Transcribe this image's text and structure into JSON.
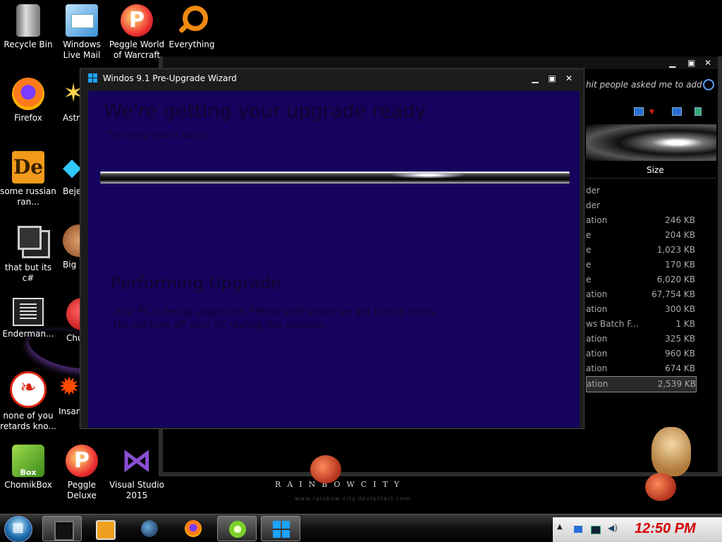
{
  "desktop_icons": [
    {
      "label": "Recycle Bin",
      "icon": "recycle-bin-icon"
    },
    {
      "label": "Windows Live Mail",
      "icon": "mail-icon"
    },
    {
      "label": "Peggle World of Warcraft",
      "icon": "peggle-icon"
    },
    {
      "label": "Everything",
      "icon": "magnifier-icon"
    },
    {
      "label": "Firefox",
      "icon": "firefox-icon"
    },
    {
      "label": "Astr De",
      "icon": "star-icon"
    },
    {
      "label": "some russian ran...",
      "icon": "de-icon"
    },
    {
      "label": "Beje De",
      "icon": "gem-icon"
    },
    {
      "label": "that but its c#",
      "icon": "windows-stack-icon"
    },
    {
      "label": "Big I De",
      "icon": "pig-icon"
    },
    {
      "label": "Enderman...",
      "icon": "list-window-icon"
    },
    {
      "label": "Chu De",
      "icon": "red-ball-icon"
    },
    {
      "label": "none of you retards kno...",
      "icon": "red-dragon-icon"
    },
    {
      "label": "Insan De",
      "icon": "burst-icon"
    },
    {
      "label": "ChomikBox",
      "icon": "chomikbox-icon"
    },
    {
      "label": "Peggle Deluxe",
      "icon": "peggle-icon"
    },
    {
      "label": "Visual Studio 2015",
      "icon": "visual-studio-icon"
    }
  ],
  "explorer": {
    "search_text": "hit people asked me to add",
    "column_size": "Size",
    "rows": [
      {
        "type": "der",
        "size": ""
      },
      {
        "type": "der",
        "size": ""
      },
      {
        "type": "ation",
        "size": "246 KB"
      },
      {
        "type": "e",
        "size": "204 KB"
      },
      {
        "type": "e",
        "size": "1,023 KB"
      },
      {
        "type": "e",
        "size": "170 KB"
      },
      {
        "type": "e",
        "size": "6,020 KB"
      },
      {
        "type": "ation",
        "size": "67,754 KB"
      },
      {
        "type": "ation",
        "size": "300 KB"
      },
      {
        "type": "ws Batch F...",
        "size": "1 KB"
      },
      {
        "type": "ation",
        "size": "325 KB"
      },
      {
        "type": "ation",
        "size": "960 KB"
      },
      {
        "type": "ation",
        "size": "674 KB"
      },
      {
        "type": "ation",
        "size": "2,539 KB"
      }
    ]
  },
  "wizard": {
    "title": "Windos 9.1 Pre-Upgrade Wizard",
    "heading": "We're getting your upgrade ready",
    "subheading": "This may take a while",
    "section_title": "Performing Upgrade",
    "section_desc": "Your PC is being upgraded. Please wait while we get things ready. Do not turn off your PC during this process."
  },
  "wallpaper": {
    "brand": "RAINBOWCITY",
    "sub": "www.rainbow-city.deviantart.com"
  },
  "taskbar": {
    "clock": "12:50 PM",
    "items": [
      "box-app-icon",
      "media-player-icon",
      "globe-icon",
      "firefox-icon",
      "lime-icon",
      "windows-logo-icon"
    ]
  },
  "colors": {
    "wizard_background": "#16035e",
    "clock": "#d40000",
    "accent_blue": "#1aa3ff"
  }
}
